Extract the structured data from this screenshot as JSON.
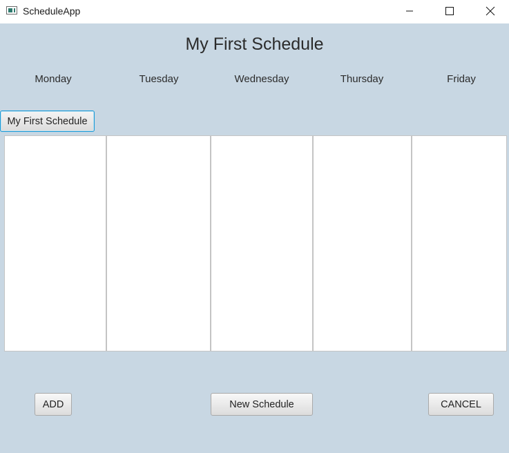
{
  "window": {
    "title": "ScheduleApp",
    "icon": "app-window-icon"
  },
  "header": {
    "title": "My First Schedule"
  },
  "days": [
    "Monday",
    "Tuesday",
    "Wednesday",
    "Thursday",
    "Friday"
  ],
  "schedule_tab": {
    "label": "My First Schedule"
  },
  "buttons": {
    "add": "ADD",
    "new_schedule": "New Schedule",
    "cancel": "CANCEL"
  },
  "colors": {
    "background": "#c8d7e3",
    "focus_accent": "#1a9ad6"
  }
}
